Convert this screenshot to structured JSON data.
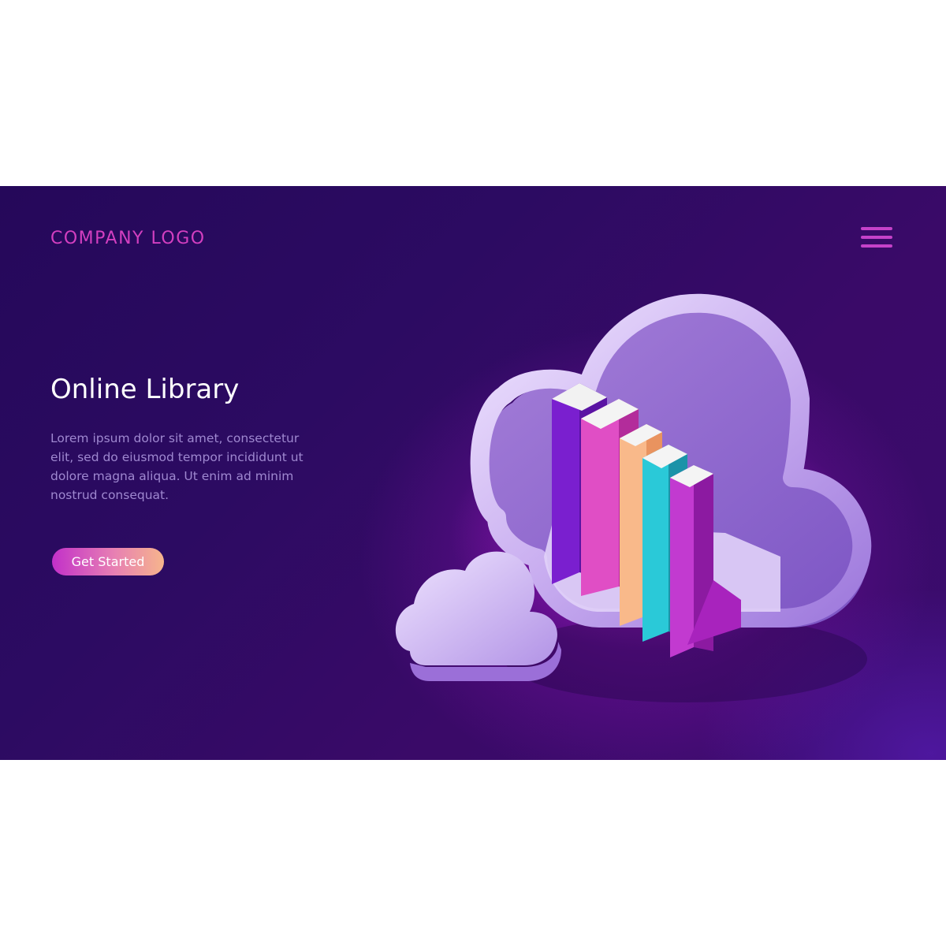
{
  "header": {
    "logo_text": "COMPANY LOGO"
  },
  "menu": {
    "icon": "hamburger-menu-icon"
  },
  "hero": {
    "title": "Online Library",
    "description": "Lorem ipsum dolor sit amet, consectetur elit, sed do eiusmod tempor incididunt ut dolore magna aliqua. Ut enim ad minim nostrud consequat.",
    "cta_label": "Get Started"
  },
  "illustration": {
    "subject": "cloud-library-icon",
    "book_colors": [
      "#7a1fcf",
      "#e04ec5",
      "#f9b98a",
      "#2ac9d8",
      "#b42fc4"
    ]
  },
  "colors": {
    "background": "#2c0b62",
    "accent": "#d33fc0",
    "button_gradient_start": "#c230c9",
    "button_gradient_end": "#f6b58c",
    "body_text": "#9f88d0"
  }
}
